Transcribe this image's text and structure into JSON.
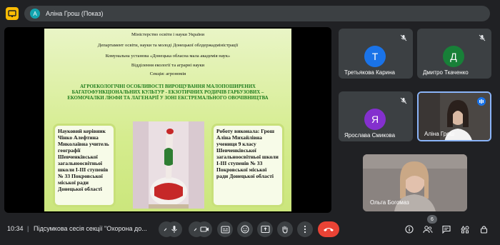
{
  "presenter_label": "Аліна Грош (Показ)",
  "presenter_initial": "А",
  "slide": {
    "header_lines": [
      "Міністерство освіти і науки України",
      "Департамент освіти, науки та молоді Донецької облдержадміністрації",
      "Комунальна установа «Донецька обласна мала академія наук»",
      "Відділення екології та аграрні науки",
      "Секція: агрономія"
    ],
    "title": "АГРОЕКОЛОГІЧНІ ОСОБЛИВОСТІ ВИРОЩУВАННЯ МАЛОПОШИРЕНИХ БАГАТОФУНКЦІОНАЛЬНИХ КУЛЬТУР  -  ЕКЗОТИЧНИХ РОДИЧІВ ГАРБУЗОВИХ – ЕКОМОЧАЛКИ ЛЮФИ ТА ЛАГЕНАРІЇ У ЗОНІ ЕКСТРЕМАЛЬНОГО ОВОЧІВНИЦТВА",
    "supervisor": "Науковий керівник Чінко Алефтина Миколаївна учитель географії Шевченківської загальноосвітньої школи І-ІІІ ступенів № 33 Покровської міської ради Донецької області",
    "author": "Роботу виконала: Грош Аліна Михайлівна учениця 9 класу Шевченківської загальноосвітньої школи І-ІІІ ступенів № 33 Покровської міської ради Донецької області"
  },
  "participants": [
    {
      "name": "Третьякова Карина",
      "initial": "Т",
      "color": "#1a73e8"
    },
    {
      "name": "Дмитро Ткаченко",
      "initial": "Д",
      "color": "#188038"
    },
    {
      "name": "Ярослава Смикова",
      "initial": "Я",
      "color": "#8430ce"
    },
    {
      "name": "Аліна Грош",
      "video": true
    }
  ],
  "main_video_name": "Ольга Богомаз",
  "participant_count": "6",
  "bottom": {
    "time": "10:34",
    "separator": "|",
    "meeting_title": "Підсумкова сесія секції \"Охорона до..."
  },
  "colors": {
    "end_call": "#ea4335",
    "accent": "#8ab4f8",
    "background": "#202124"
  },
  "icons": [
    "presentation-icon",
    "chevron-up-icon",
    "mic-icon",
    "camera-icon",
    "captions-icon",
    "emoji-icon",
    "present-icon",
    "raise-hand-icon",
    "more-icon",
    "end-call-icon",
    "info-icon",
    "people-icon",
    "chat-icon",
    "activities-icon",
    "lock-icon"
  ]
}
